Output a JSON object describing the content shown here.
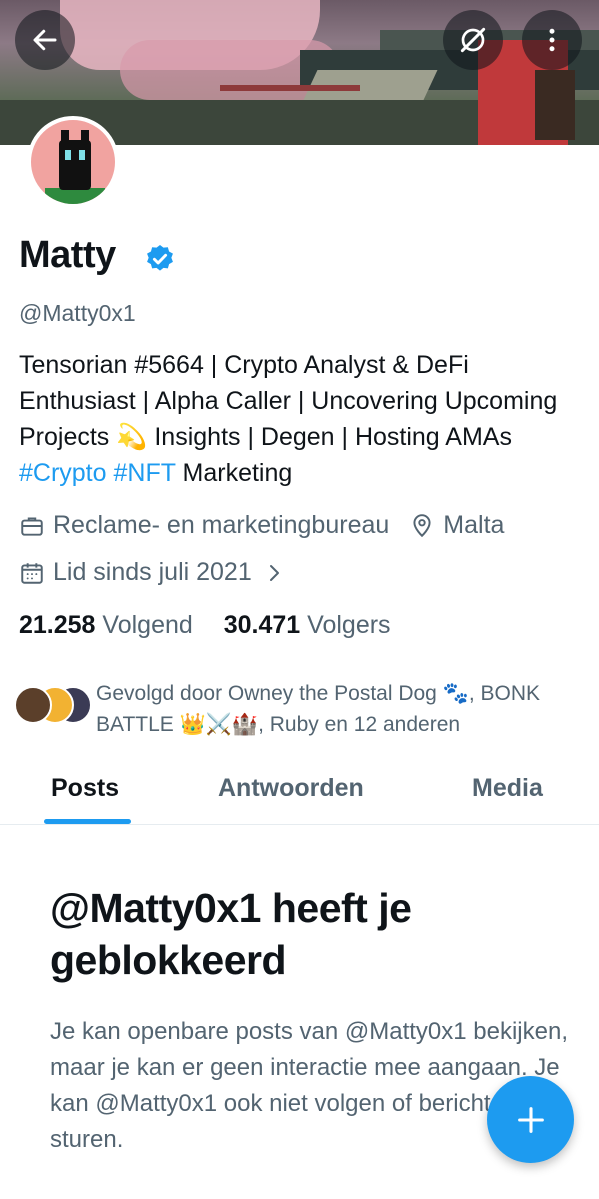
{
  "header": {
    "back_icon": "arrow-left-icon",
    "grok_icon": "grok-slash-icon",
    "more_icon": "more-vertical-icon"
  },
  "profile": {
    "name": "Matty",
    "verified": true,
    "handle": "@Matty0x1",
    "bio_parts": {
      "text1": "Tensorian #5664 | Crypto Analyst & DeFi Enthusiast | Alpha Caller | Uncovering Upcoming Projects ",
      "emoji": "💫",
      "text2": " Insights | Degen | Hosting AMAs ",
      "tag1": "#Crypto",
      "space": " ",
      "tag2": "#NFT",
      "text3": " Marketing"
    },
    "category": "Reclame- en marketingbureau",
    "location": "Malta",
    "joined": "Lid sinds juli 2021",
    "following_count": "21.258",
    "following_label": "Volgend",
    "followers_count": "30.471",
    "followers_label": "Volgers",
    "followed_by": "Gevolgd door Owney the Postal Dog 🐾, BONK BATTLE 👑⚔️🏰, Ruby en 12 anderen"
  },
  "tabs": [
    {
      "label": "Posts"
    },
    {
      "label": "Antwoorden"
    },
    {
      "label": "Media"
    }
  ],
  "blocked": {
    "title": "@Matty0x1 heeft je geblokkeerd",
    "body": "Je kan openbare posts van @Matty0x1 bekijken, maar je kan er geen interactie mee aangaan. Je kan @Matty0x1 ook niet volgen of berichten sturen."
  },
  "colors": {
    "accent": "#1d9bf0",
    "text": "#0f1419",
    "secondary": "#536471"
  }
}
